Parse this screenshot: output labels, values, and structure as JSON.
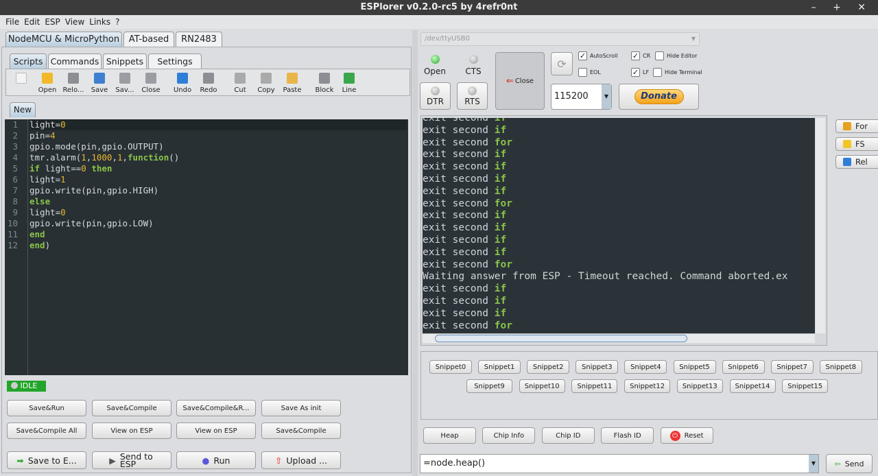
{
  "window": {
    "title": "ESPlorer v0.2.0-rc5 by 4refr0nt",
    "controls": "– + ✕"
  },
  "menu": [
    "File",
    "Edit",
    "ESP",
    "View",
    "Links",
    "?"
  ],
  "device_tabs": [
    "NodeMCU & MicroPython",
    "AT-based",
    "RN2483"
  ],
  "sub_tabs": [
    "Scripts",
    "Commands",
    "Snippets",
    "Settings"
  ],
  "toolbar": [
    {
      "label": "",
      "icon": "new-file-icon"
    },
    {
      "label": "Open",
      "icon": "folder-icon"
    },
    {
      "label": "Relo...",
      "icon": "reload-icon"
    },
    {
      "label": "Save",
      "icon": "save-icon"
    },
    {
      "label": "Sav...",
      "icon": "save-as-icon"
    },
    {
      "label": "Close",
      "icon": "close-file-icon"
    },
    {
      "label": "Undo",
      "icon": "undo-icon"
    },
    {
      "label": "Redo",
      "icon": "redo-icon"
    },
    {
      "label": "Cut",
      "icon": "scissors-icon"
    },
    {
      "label": "Copy",
      "icon": "copy-icon"
    },
    {
      "label": "Paste",
      "icon": "paste-icon"
    },
    {
      "label": "Block",
      "icon": "block-icon"
    },
    {
      "label": "Line",
      "icon": "line-icon"
    }
  ],
  "file_tab": "New",
  "code": [
    [
      [
        "light=",
        ""
      ],
      [
        "0",
        "n"
      ]
    ],
    [
      [
        "pin=",
        ""
      ],
      [
        "4",
        "n"
      ]
    ],
    [
      [
        "gpio.mode(pin,gpio.OUTPUT)",
        ""
      ]
    ],
    [
      [
        "tmr.alarm(",
        ""
      ],
      [
        "1",
        "n"
      ],
      [
        ",",
        ""
      ],
      [
        "1000",
        "n"
      ],
      [
        ",",
        ""
      ],
      [
        "1",
        "n"
      ],
      [
        ",",
        ""
      ],
      [
        "function",
        "k"
      ],
      [
        "()",
        ""
      ]
    ],
    [
      [
        "if",
        "k"
      ],
      [
        " light==",
        ""
      ],
      [
        "0",
        "n"
      ],
      [
        " ",
        ""
      ],
      [
        "then",
        "k"
      ]
    ],
    [
      [
        "light=",
        ""
      ],
      [
        "1",
        "n"
      ]
    ],
    [
      [
        "gpio.write(pin,gpio.HIGH)",
        ""
      ]
    ],
    [
      [
        "else",
        "k"
      ]
    ],
    [
      [
        "light=",
        ""
      ],
      [
        "0",
        "n"
      ]
    ],
    [
      [
        "gpio.write(pin,gpio.LOW)",
        ""
      ]
    ],
    [
      [
        "end",
        "k"
      ]
    ],
    [
      [
        "end",
        "k"
      ],
      [
        ")",
        ""
      ]
    ]
  ],
  "status": "IDLE",
  "action_buttons": [
    [
      "Save&Run",
      "Save&Compile",
      "Save&Compile&R...",
      "Save As init"
    ],
    [
      "Save&Compile All",
      "View on ESP",
      "View on ESP",
      "Save&Compile"
    ]
  ],
  "bottom_buttons": [
    "Save to E...",
    "Send to ESP",
    "Run",
    "Upload ..."
  ],
  "port": "/dev/ttyUSB0",
  "leds": {
    "open": "Open",
    "cts": "CTS",
    "dtr": "DTR",
    "rts": "RTS"
  },
  "close_button": "Close",
  "baud": "115200",
  "checkboxes": [
    {
      "label": "AutoScroll",
      "checked": true
    },
    {
      "label": "EOL",
      "checked": false
    },
    {
      "label": "CR",
      "checked": true
    },
    {
      "label": "LF",
      "checked": true
    },
    {
      "label": "Hide Editor",
      "checked": false
    },
    {
      "label": "Hide Terminal",
      "checked": false
    }
  ],
  "donate": "Donate",
  "terminal": [
    [
      "exit second ",
      "if"
    ],
    [
      "exit second ",
      "for"
    ],
    [
      "exit second ",
      "if"
    ],
    [
      "exit second ",
      "if"
    ],
    [
      "exit second ",
      "if"
    ],
    [
      "exit second ",
      "if"
    ],
    [
      "exit second ",
      "for"
    ],
    [
      "exit second ",
      "if"
    ],
    [
      "exit second ",
      "if"
    ],
    [
      "exit second ",
      "if"
    ],
    [
      "exit second ",
      "if"
    ],
    [
      "exit second ",
      "for"
    ],
    [
      "Waiting answer from ESP - Timeout reached. Command aborted.ex",
      ""
    ],
    [
      "exit second ",
      "if"
    ],
    [
      "exit second ",
      "if"
    ],
    [
      "exit second ",
      "if"
    ],
    [
      "exit second ",
      "for"
    ]
  ],
  "side_buttons": [
    "For",
    "FS",
    "Rel"
  ],
  "snippets": [
    "Snippet0",
    "Snippet1",
    "Snippet2",
    "Snippet3",
    "Snippet4",
    "Snippet5",
    "Snippet6",
    "Snippet7",
    "Snippet8",
    "Snippet9",
    "Snippet10",
    "Snippet11",
    "Snippet12",
    "Snippet13",
    "Snippet14",
    "Snippet15"
  ],
  "cmd_buttons": [
    "Heap",
    "Chip Info",
    "Chip ID",
    "Flash ID",
    "Reset"
  ],
  "command_input": "=node.heap()",
  "send": "Send"
}
